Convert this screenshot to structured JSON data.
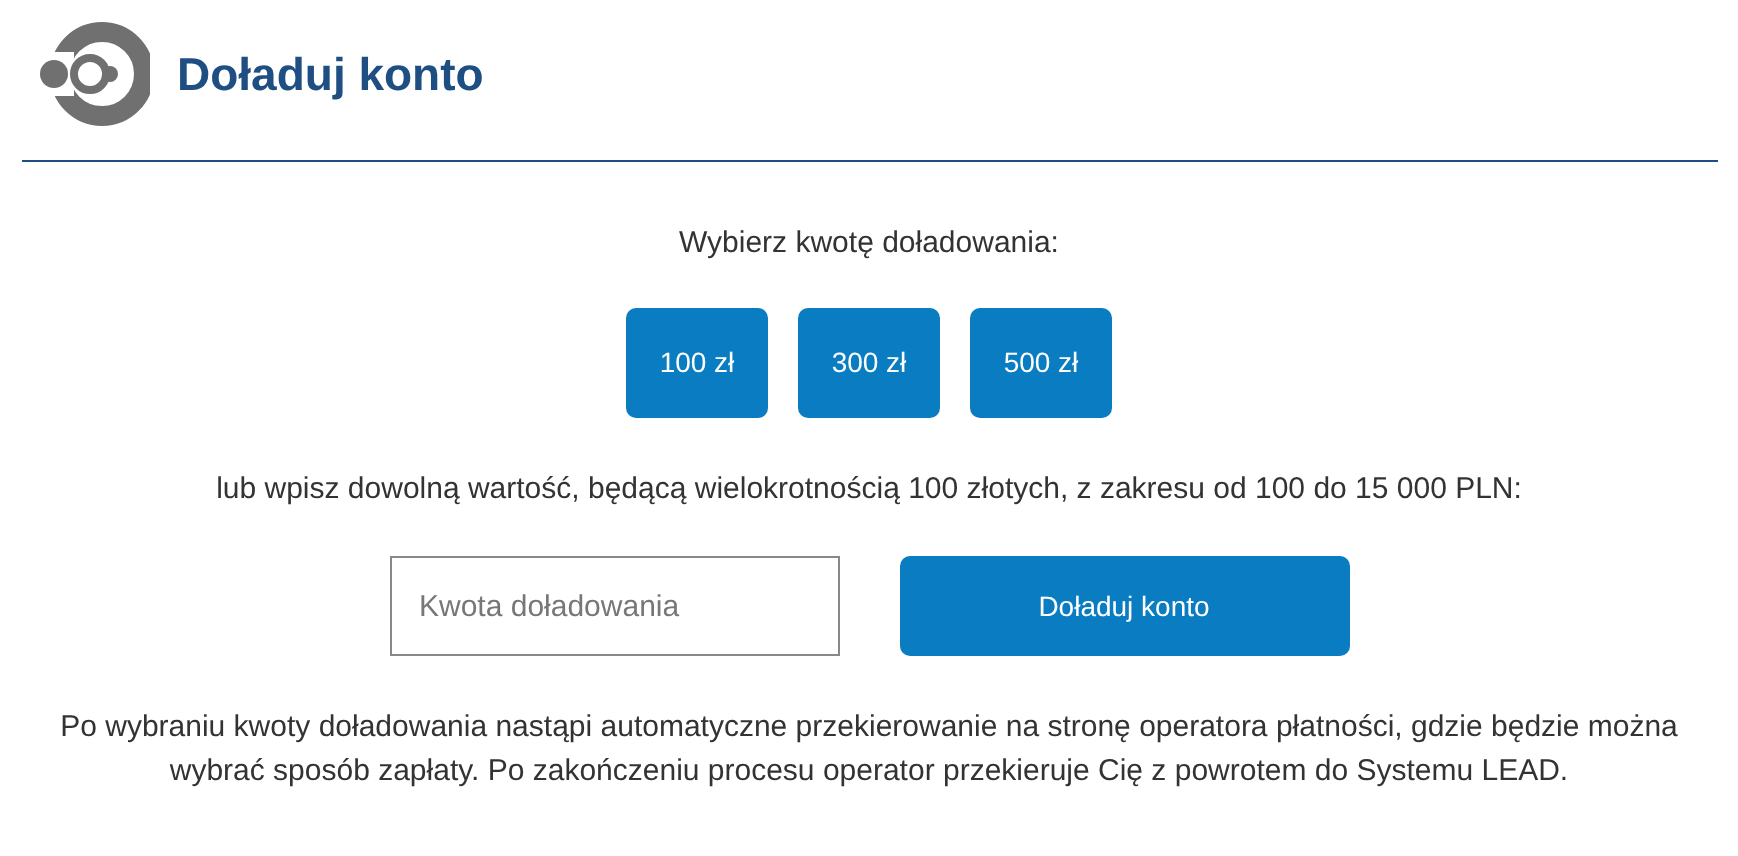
{
  "header": {
    "title": "Doładuj konto"
  },
  "prompt": "Wybierz kwotę doładowania:",
  "amounts": [
    "100 zł",
    "300 zł",
    "500 zł"
  ],
  "hint": "lub wpisz dowolną wartość, będącą wielokrotnością 100 złotych, z zakresu od 100 do 15 000 PLN:",
  "amount_field": {
    "placeholder": "Kwota doładowania"
  },
  "submit": "Doładuj konto",
  "note": "Po wybraniu kwoty doładowania nastąpi automatyczne przekierowanie na stronę operatora płatności, gdzie będzie można wybrać sposób zapłaty. Po zakończeniu procesu operator przekieruje Cię z powrotem do Systemu LEAD."
}
